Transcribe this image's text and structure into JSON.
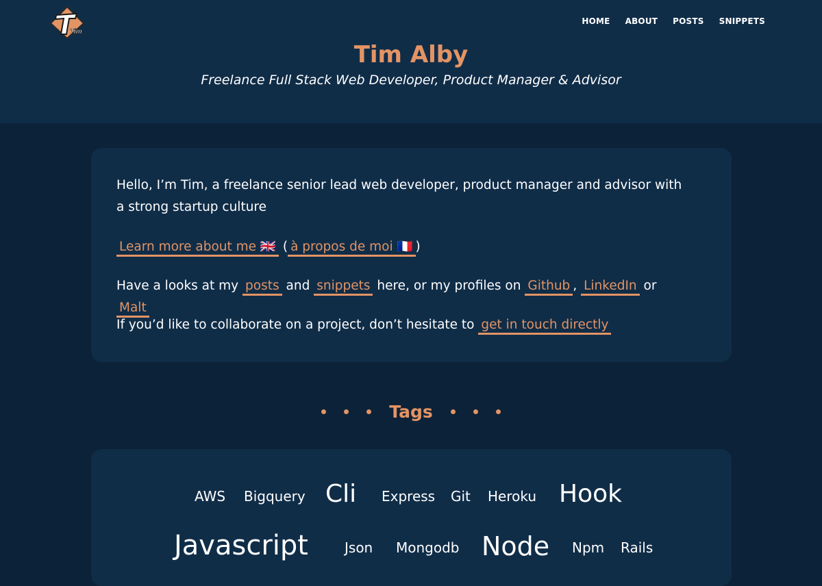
{
  "header": {
    "logo_text": "Tim",
    "nav": [
      "HOME",
      "ABOUT",
      "POSTS",
      "SNIPPETS"
    ],
    "title": "Tim Alby",
    "subtitle": "Freelance Full Stack Web Developer, Product Manager & Advisor"
  },
  "intro": {
    "line1": "Hello, I’m Tim, a freelance senior lead web developer, product manager and advisor with a strong startup culture",
    "learn_more": "Learn more about me 🇬🇧",
    "paren_open": "(",
    "a_propos": "à propos de moi 🇫🇷",
    "paren_close": ")",
    "line3_pre": "Have a looks at my",
    "posts": "posts",
    "and": "and",
    "snippets": "snippets",
    "line3_mid": "here, or my profiles on",
    "github": "Github",
    "comma": ",",
    "linkedin": "LinkedIn",
    "or": "or",
    "malt": "Malt",
    "line4_pre": "If you’d like to collaborate on a project, don’t hesitate to",
    "get_in_touch": "get in touch directly"
  },
  "tags": {
    "heading": "Tags",
    "items": [
      "AWS",
      "Bigquery",
      "Cli",
      "Express",
      "Git",
      "Heroku",
      "Hook",
      "Javascript",
      "Json",
      "Mongodb",
      "Node",
      "Npm",
      "Rails"
    ]
  },
  "colors": {
    "accent": "#e39465",
    "background": "#0c2238",
    "card": "#102d48"
  }
}
